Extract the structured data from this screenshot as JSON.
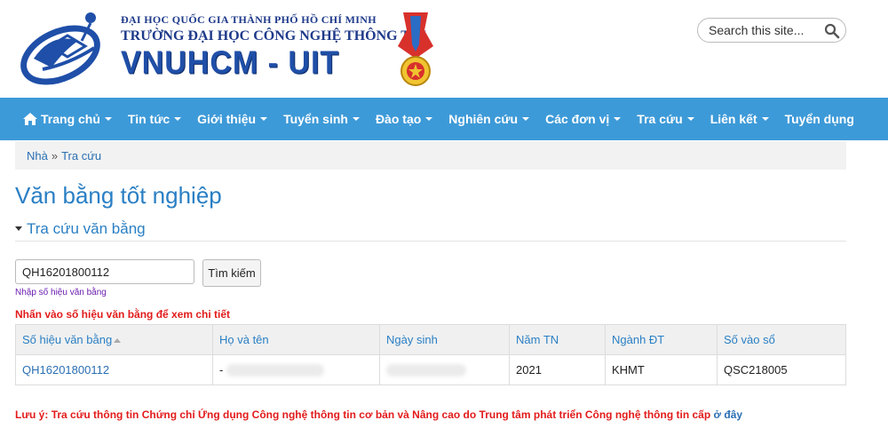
{
  "header": {
    "university_line1": "ĐẠI HỌC QUỐC GIA THÀNH PHỐ HỒ CHÍ MINH",
    "university_line2": "TRƯỜNG ĐẠI HỌC CÔNG NGHỆ THÔNG TIN",
    "brand": "VNUHCM - UIT",
    "search_placeholder": "Search this site...",
    "colors": {
      "brand_blue": "#1f4fa8",
      "nav_blue": "#3d9ad8"
    }
  },
  "nav": {
    "items": [
      {
        "label": "Trang chủ",
        "icon": "home-icon",
        "dropdown": true
      },
      {
        "label": "Tin tức",
        "dropdown": true
      },
      {
        "label": "Giới thiệu",
        "dropdown": true
      },
      {
        "label": "Tuyển sinh",
        "dropdown": true
      },
      {
        "label": "Đào tạo",
        "dropdown": true
      },
      {
        "label": "Nghiên cứu",
        "dropdown": true
      },
      {
        "label": "Các đơn vị",
        "dropdown": true
      },
      {
        "label": "Tra cứu",
        "dropdown": true
      },
      {
        "label": "Liên kết",
        "dropdown": true
      },
      {
        "label": "Tuyển dụng",
        "dropdown": false
      }
    ]
  },
  "breadcrumb": {
    "home": "Nhà",
    "separator": "»",
    "current": "Tra cứu"
  },
  "page": {
    "title": "Văn bằng tốt nghiệp",
    "section_label": "Tra cứu văn bằng",
    "query_value": "QH16201800112",
    "search_button": "Tìm kiếm",
    "hint": "Nhập số hiệu văn bằng",
    "notice": "Nhấn vào số hiệu văn bằng để xem chi tiết"
  },
  "table": {
    "headers": [
      "Số hiệu văn bằng",
      "Họ và tên",
      "Ngày sinh",
      "Năm TN",
      "Ngành ĐT",
      "Số vào sổ"
    ],
    "rows": [
      {
        "so_hieu": "QH16201800112",
        "ho_ten": "-",
        "ngay_sinh": "",
        "nam_tn": "2021",
        "nganh": "KHMT",
        "so_vao_so": "QSC218005"
      }
    ]
  },
  "footnote": {
    "text": "Lưu ý: Tra cứu thông tin Chứng chỉ Ứng dụng Công nghệ thông tin cơ bản và Nâng cao do Trung tâm phát triển Công nghệ thông tin cấp ",
    "link": "ở đây"
  }
}
